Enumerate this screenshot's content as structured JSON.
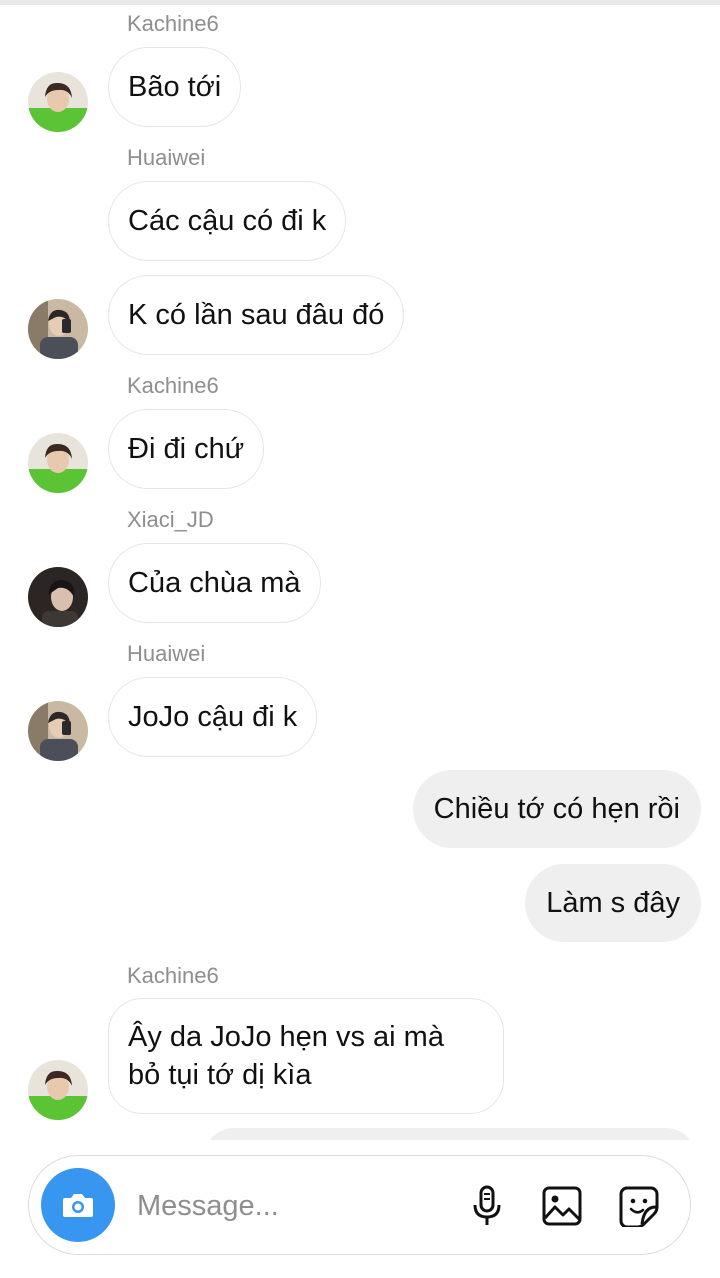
{
  "messages": [
    {
      "sender": "Kachine6",
      "text": "Bão tới"
    },
    {
      "sender": "Huaiwei",
      "text": "Các cậu có đi k"
    },
    {
      "text": "K có lần sau đâu đó"
    },
    {
      "sender": "Kachine6",
      "text": "Đi đi chứ"
    },
    {
      "sender": "Xiaci_JD",
      "text": "Của chùa mà"
    },
    {
      "sender": "Huaiwei",
      "text": "JoJo cậu đi k"
    },
    {
      "text": "Chiều tớ có hẹn rồi"
    },
    {
      "text": "Làm s đây"
    },
    {
      "sender": "Kachine6",
      "line1": "Ây da JoJo hẹn vs ai mà",
      "line2": "bỏ tụi tớ dị kìa"
    }
  ],
  "composer": {
    "placeholder": "Message...",
    "icons": [
      "camera-icon",
      "microphone-icon",
      "gallery-icon",
      "sticker-icon"
    ]
  },
  "colors": {
    "accent": "#3797f0",
    "outgoing_bubble": "#efefef",
    "incoming_border": "#e6e6e6",
    "sender_name": "#8e8e8e"
  }
}
